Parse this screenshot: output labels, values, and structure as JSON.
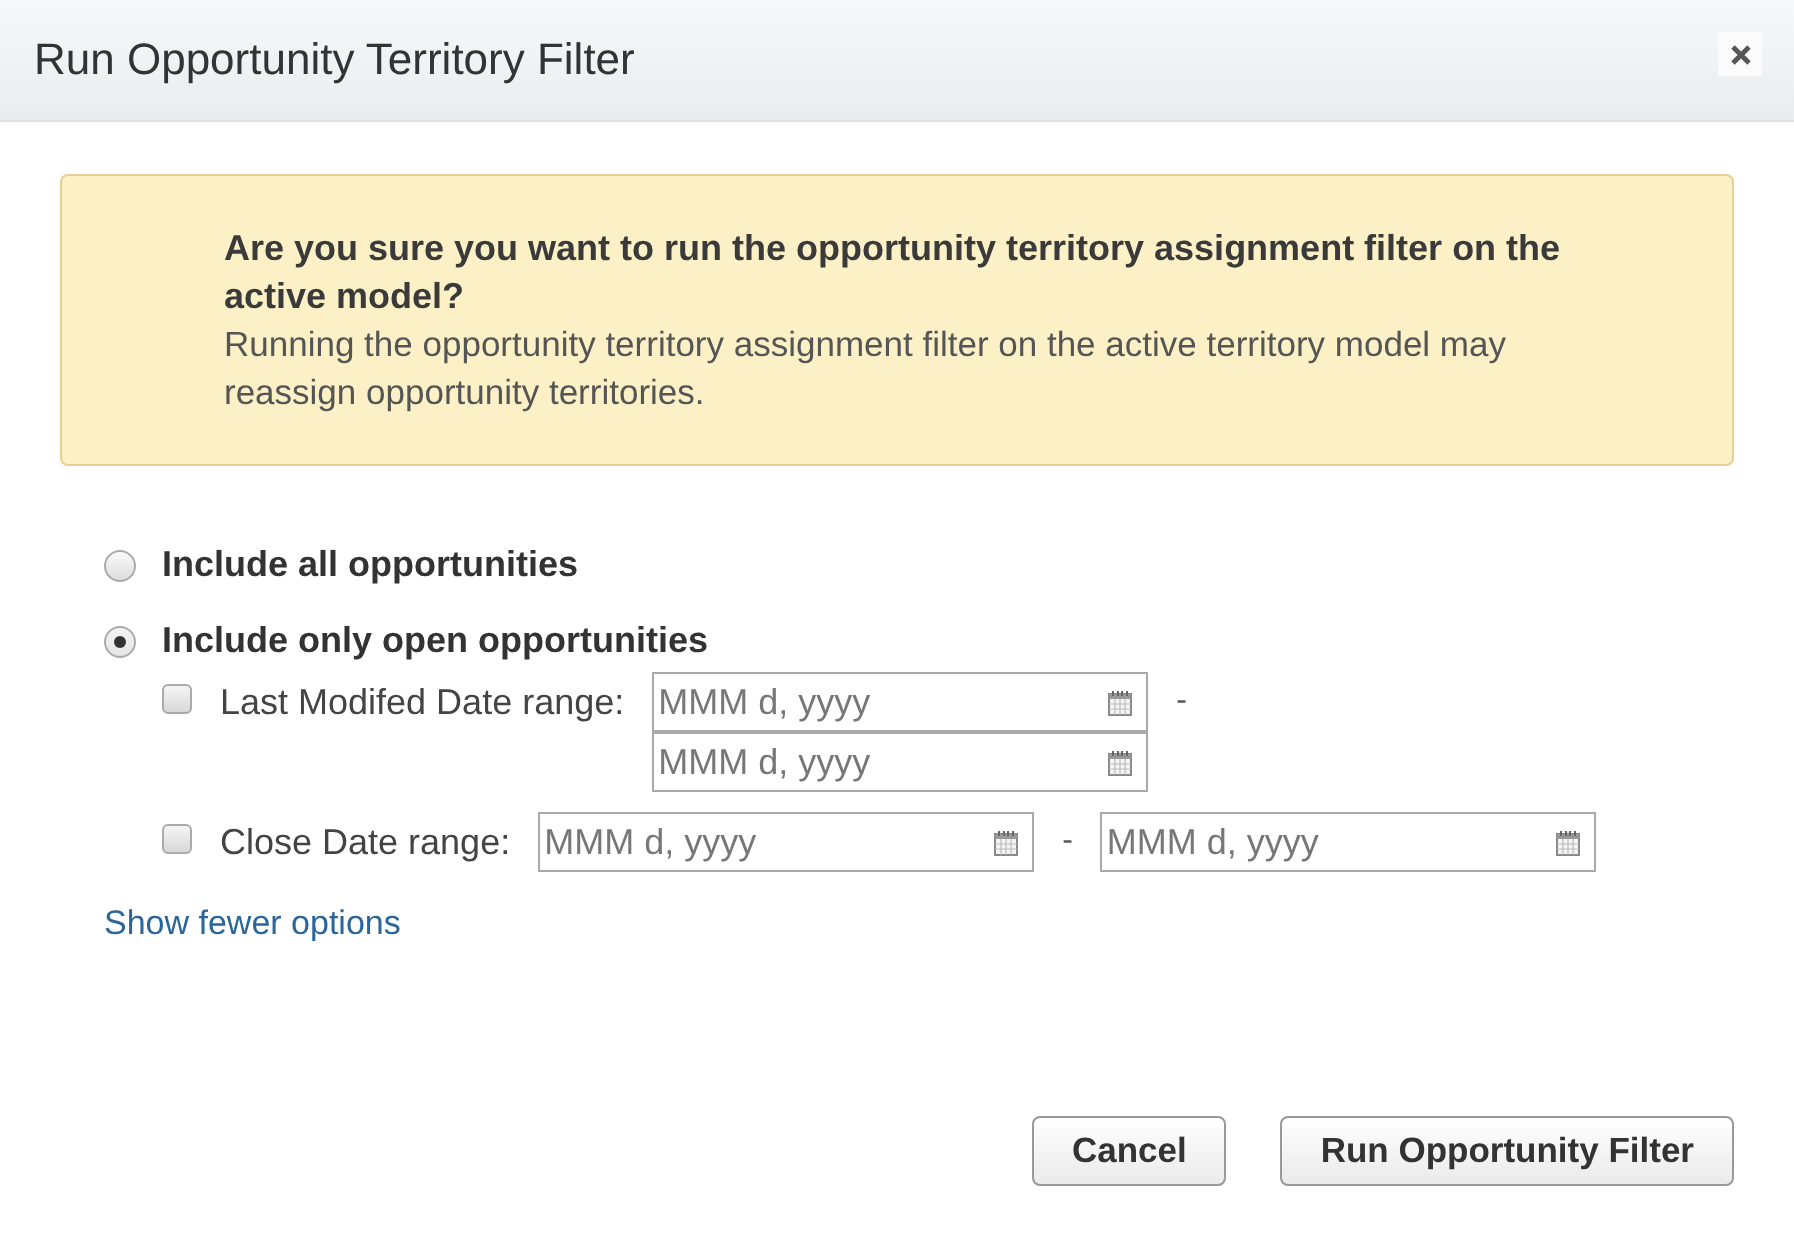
{
  "dialog": {
    "title": "Run Opportunity Territory Filter"
  },
  "alert": {
    "heading": "Are you sure you want to run the opportunity territory assignment filter on the active model?",
    "message": "Running the opportunity territory assignment filter on the active territory model may reassign opportunity territories."
  },
  "options": [
    {
      "label": "Include all opportunities",
      "selected": false
    },
    {
      "label": "Include only open opportunities",
      "selected": true
    }
  ],
  "filters": [
    {
      "kind": "stacked",
      "label": "Last Modifed Date range:",
      "checked": false,
      "from": {
        "placeholder": "MMM d, yyyy"
      },
      "separator": "-",
      "to": {
        "placeholder": "MMM d, yyyy"
      }
    },
    {
      "kind": "inline",
      "label": "Close Date range:",
      "checked": false,
      "from": {
        "placeholder": "MMM d, yyyy"
      },
      "separator": "-",
      "to": {
        "placeholder": "MMM d, yyyy"
      }
    }
  ],
  "link": "Show fewer options",
  "buttons": [
    {
      "label": "Cancel"
    },
    {
      "label": "Run Opportunity Filter"
    }
  ]
}
